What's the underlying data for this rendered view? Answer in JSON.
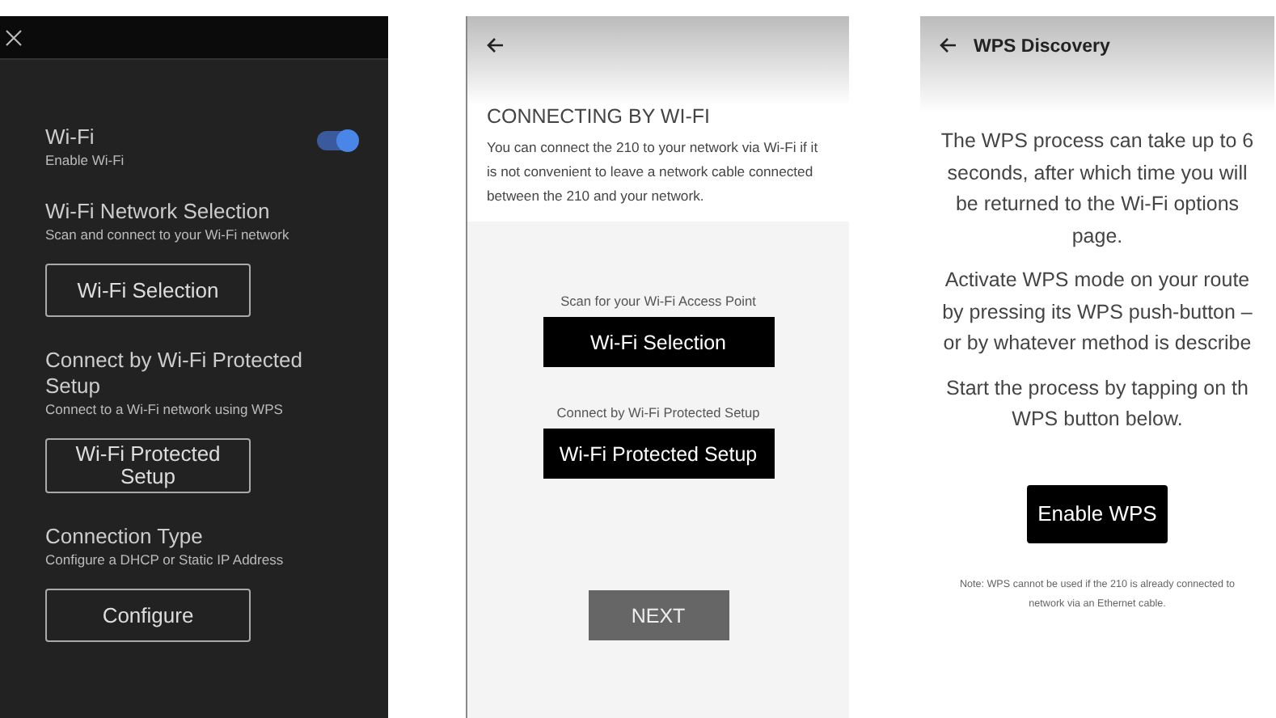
{
  "settings_screen": {
    "sections": [
      {
        "kind": "toggle",
        "title": "Wi-Fi",
        "subtitle": "Enable Wi-Fi",
        "on": true
      },
      {
        "kind": "button",
        "title": "Wi-Fi Network Selection",
        "subtitle": "Scan and connect to your Wi-Fi network",
        "button": "Wi-Fi Selection"
      },
      {
        "kind": "button",
        "title": "Connect by Wi-Fi Protected Setup",
        "subtitle": "Connect to a Wi-Fi network using WPS",
        "button": "Wi-Fi Protected Setup"
      },
      {
        "kind": "button",
        "title": "Connection Type",
        "subtitle": "Configure a DHCP or Static IP Address",
        "button": "Configure"
      }
    ]
  },
  "connecting_screen": {
    "heading": "CONNECTING BY WI-FI",
    "body": "You can connect the 210 to your network via Wi-Fi if it is not convenient to leave a network cable connected between the 210 and your network.",
    "options": [
      {
        "label": "Scan for your Wi-Fi Access Point",
        "button": "Wi-Fi Selection"
      },
      {
        "label": "Connect by Wi-Fi Protected Setup",
        "button": "Wi-Fi Protected Setup"
      }
    ],
    "next_button": "NEXT"
  },
  "wps_screen": {
    "title": "WPS Discovery",
    "paragraphs": [
      [
        "The WPS process can take up to 6",
        "seconds, after which time you will",
        "be returned to the Wi-Fi options",
        "page."
      ],
      [
        "Activate WPS mode on your route",
        "by pressing its WPS push-button –",
        "or by whatever method is describe"
      ],
      [
        "Start the process by tapping on th",
        "WPS button below."
      ]
    ],
    "button": "Enable WPS",
    "note": [
      "Note: WPS cannot be used if the 210 is already connected to",
      "network via an Ethernet cable."
    ]
  }
}
